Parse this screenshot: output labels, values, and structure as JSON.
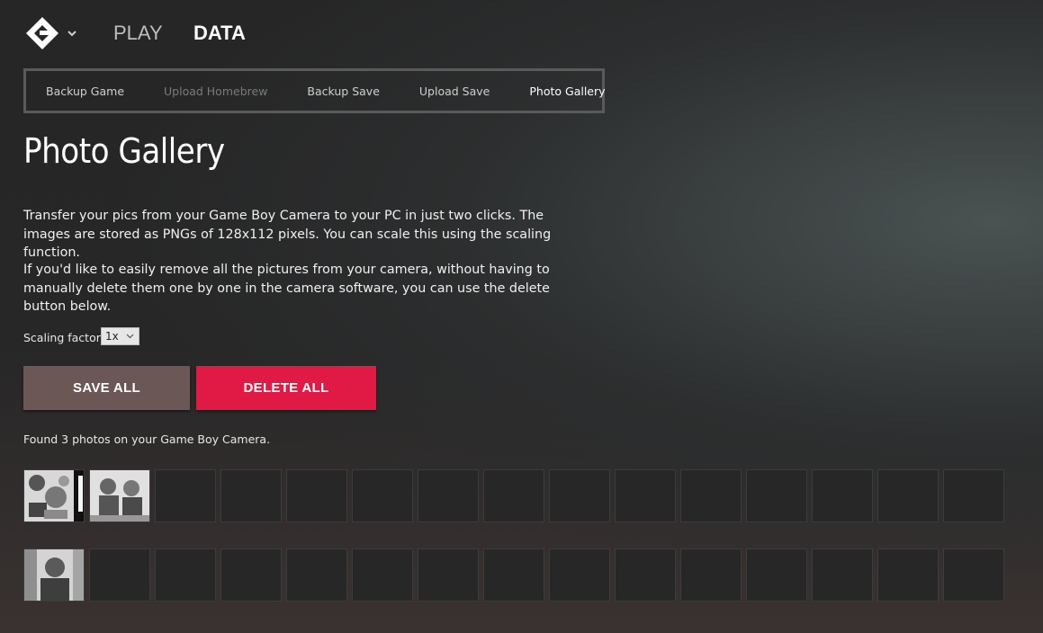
{
  "nav": {
    "play": "PLAY",
    "data": "DATA"
  },
  "subnav": {
    "items": [
      {
        "label": "Backup Game"
      },
      {
        "label": "Upload Homebrew"
      },
      {
        "label": "Backup Save"
      },
      {
        "label": "Upload Save"
      },
      {
        "label": "Photo Gallery"
      }
    ]
  },
  "page": {
    "title": "Photo Gallery",
    "para1": "Transfer your pics from your Game Boy Camera to your PC in just two clicks. The images are stored as PNGs of 128x112 pixels. You can scale this using the scaling function.",
    "para2": "If you'd like to easily remove all the pictures from your camera, without having to manually delete them one by one in the camera software, you can use the delete button below."
  },
  "scaling": {
    "label": "Scaling factor:",
    "value": "1x"
  },
  "buttons": {
    "save": "SAVE ALL",
    "delete": "DELETE ALL"
  },
  "status": "Found 3 photos on your Game Boy Camera.",
  "colors": {
    "delete": "#e01a45",
    "save": "#6b5755"
  }
}
